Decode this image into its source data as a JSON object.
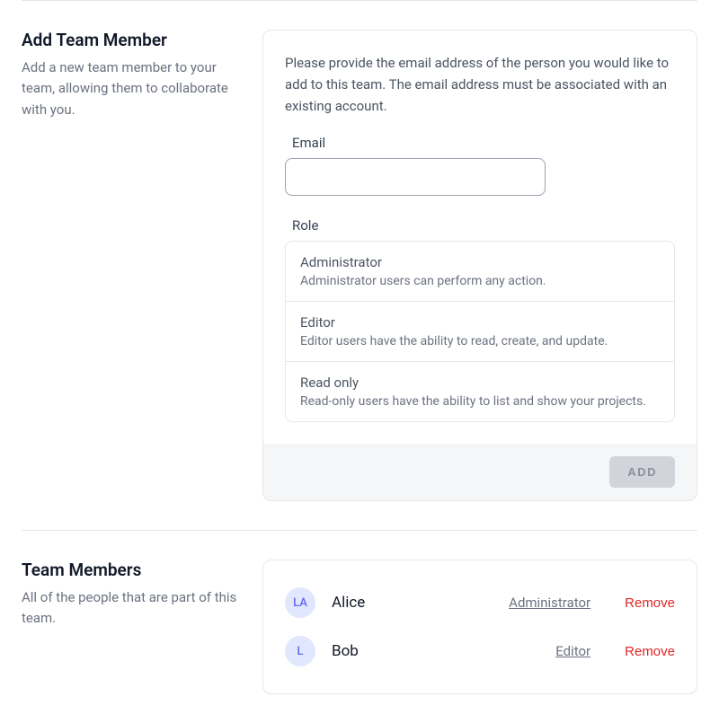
{
  "addMember": {
    "title": "Add Team Member",
    "description": "Add a new team member to your team, allowing them to collaborate with you.",
    "intro": "Please provide the email address of the person you would like to add to this team. The email address must be associated with an existing account.",
    "emailLabel": "Email",
    "emailValue": "",
    "roleLabel": "Role",
    "roles": [
      {
        "name": "Administrator",
        "desc": "Administrator users can perform any action."
      },
      {
        "name": "Editor",
        "desc": "Editor users have the ability to read, create, and update."
      },
      {
        "name": "Read only",
        "desc": "Read-only users have the ability to list and show your projects."
      }
    ],
    "addButton": "ADD"
  },
  "teamMembers": {
    "title": "Team Members",
    "description": "All of the people that are part of this team.",
    "removeLabel": "Remove",
    "members": [
      {
        "initials": "LA",
        "name": "Alice",
        "role": "Administrator"
      },
      {
        "initials": "L",
        "name": "Bob",
        "role": "Editor"
      }
    ]
  }
}
